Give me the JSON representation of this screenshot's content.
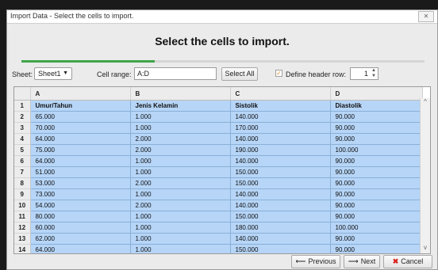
{
  "window": {
    "title": "Import Data - Select the cells to import.",
    "close_glyph": "✕"
  },
  "header": {
    "heading": "Select the cells to import.",
    "progress_fraction": 0.33,
    "progress_color": "#3fa548"
  },
  "toolbar": {
    "sheet_label": "Sheet:",
    "sheet_value": "Sheet1",
    "cell_range_label": "Cell range:",
    "cell_range_value": "A:D",
    "select_all_label": "Select All",
    "define_header_label": "Define header row:",
    "define_header_checked": true,
    "header_row_value": "1"
  },
  "grid": {
    "columns": [
      "A",
      "B",
      "C",
      "D"
    ],
    "rows": [
      {
        "n": "1",
        "cells": [
          "Umur/Tahun",
          "Jenis Kelamin",
          "Sistolik",
          "Diastolik"
        ]
      },
      {
        "n": "2",
        "cells": [
          "65.000",
          "1.000",
          "140.000",
          "90.000"
        ]
      },
      {
        "n": "3",
        "cells": [
          "70.000",
          "1.000",
          "170.000",
          "90.000"
        ]
      },
      {
        "n": "4",
        "cells": [
          "64.000",
          "2.000",
          "140.000",
          "90.000"
        ]
      },
      {
        "n": "5",
        "cells": [
          "75.000",
          "2.000",
          "190.000",
          "100.000"
        ]
      },
      {
        "n": "6",
        "cells": [
          "64.000",
          "1.000",
          "140.000",
          "90.000"
        ]
      },
      {
        "n": "7",
        "cells": [
          "51.000",
          "1.000",
          "150.000",
          "90.000"
        ]
      },
      {
        "n": "8",
        "cells": [
          "53.000",
          "2.000",
          "150.000",
          "90.000"
        ]
      },
      {
        "n": "9",
        "cells": [
          "73.000",
          "1.000",
          "140.000",
          "90.000"
        ]
      },
      {
        "n": "10",
        "cells": [
          "54.000",
          "2.000",
          "140.000",
          "90.000"
        ]
      },
      {
        "n": "11",
        "cells": [
          "80.000",
          "1.000",
          "150.000",
          "90.000"
        ]
      },
      {
        "n": "12",
        "cells": [
          "60.000",
          "1.000",
          "180.000",
          "100.000"
        ]
      },
      {
        "n": "13",
        "cells": [
          "62.000",
          "1.000",
          "140.000",
          "90.000"
        ]
      },
      {
        "n": "14",
        "cells": [
          "64.000",
          "1.000",
          "150.000",
          "90.000"
        ]
      }
    ],
    "selection_color": "#b6d5f7"
  },
  "footer": {
    "previous_label": "Previous",
    "next_label": "Next",
    "cancel_label": "Cancel"
  },
  "icons": {
    "previous_icon": "arrow-left-icon",
    "next_icon": "arrow-right-icon",
    "cancel_icon": "red-x-icon",
    "checkbox_check": "✓",
    "dropdown_arrow": "▼",
    "spinner_arrows": "▲▼"
  }
}
